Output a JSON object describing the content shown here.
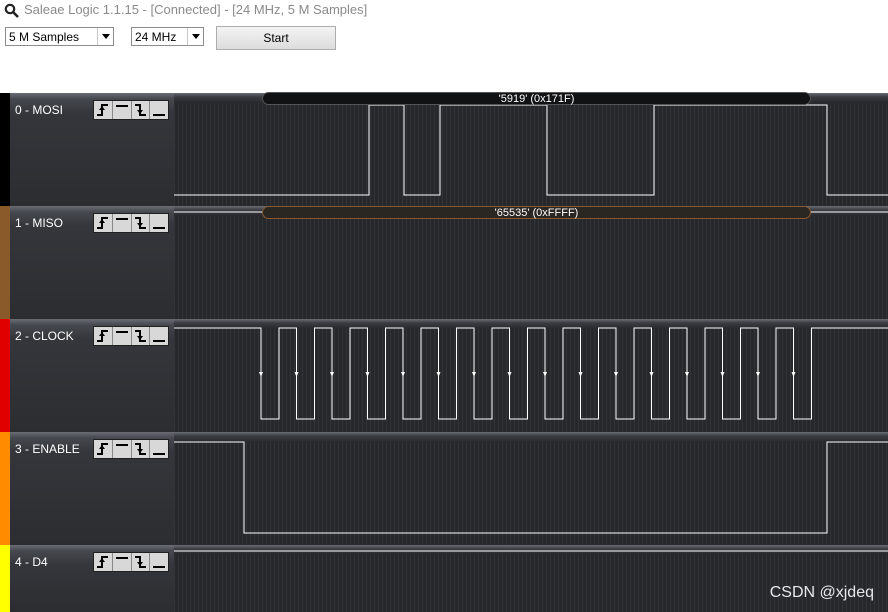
{
  "window": {
    "title": "Saleae Logic 1.1.15 - [Connected] - [24 MHz, 5 M Samples]",
    "icon": "magnifier-icon"
  },
  "toolbar": {
    "samples_select": "5 M Samples",
    "rate_select": "24 MHz",
    "start_label": "Start"
  },
  "channels": [
    {
      "label": "0 - MOSI",
      "color": "#000000"
    },
    {
      "label": "1 - MISO",
      "color": "#8b5a2b"
    },
    {
      "label": "2 - CLOCK",
      "color": "#e00000"
    },
    {
      "label": "3 - ENABLE",
      "color": "#ff8c00"
    },
    {
      "label": "4 - D4",
      "color": "#ffff00"
    }
  ],
  "decoded": {
    "mosi": "'5919' (0x171F)",
    "miso": "'65535' (0xFFFF)"
  },
  "watermark": "CSDN @xjdeq",
  "colors": {
    "trace": "#ffffff",
    "background": "#2b2d31",
    "bubble_border_miso": "#8a5a2e"
  }
}
